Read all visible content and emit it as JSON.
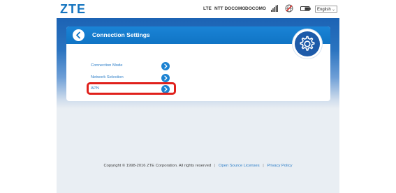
{
  "header": {
    "logo": "ZTE",
    "network_type": "LTE",
    "operator_1": "NTT DOCOMO",
    "operator_2": "DOCOMO",
    "signal_icon": "signal-bars-icon",
    "roaming_icon": "globe-icon",
    "battery_icon": "battery-icon",
    "language": {
      "selected": "English"
    }
  },
  "card": {
    "title": "Connection Settings",
    "back_icon": "chevron-left-icon",
    "badge_icon": "gear-icon",
    "items": [
      {
        "label": "Connection Mode",
        "icon": "chevron-right-icon"
      },
      {
        "label": "Network Selection",
        "icon": "chevron-right-icon"
      },
      {
        "label": "APN",
        "icon": "chevron-right-icon",
        "highlighted": true
      }
    ]
  },
  "footer": {
    "copyright": "Copyright © 1998-2016 ZTE Corporation. All rights reserved",
    "sep1": "|",
    "open_source": "Open Source Licenses",
    "sep2": "|",
    "privacy": "Privacy Policy"
  },
  "colors": {
    "brand_blue": "#1474bf",
    "header_blue": "#1074c5",
    "highlight_red": "#e0201b"
  }
}
